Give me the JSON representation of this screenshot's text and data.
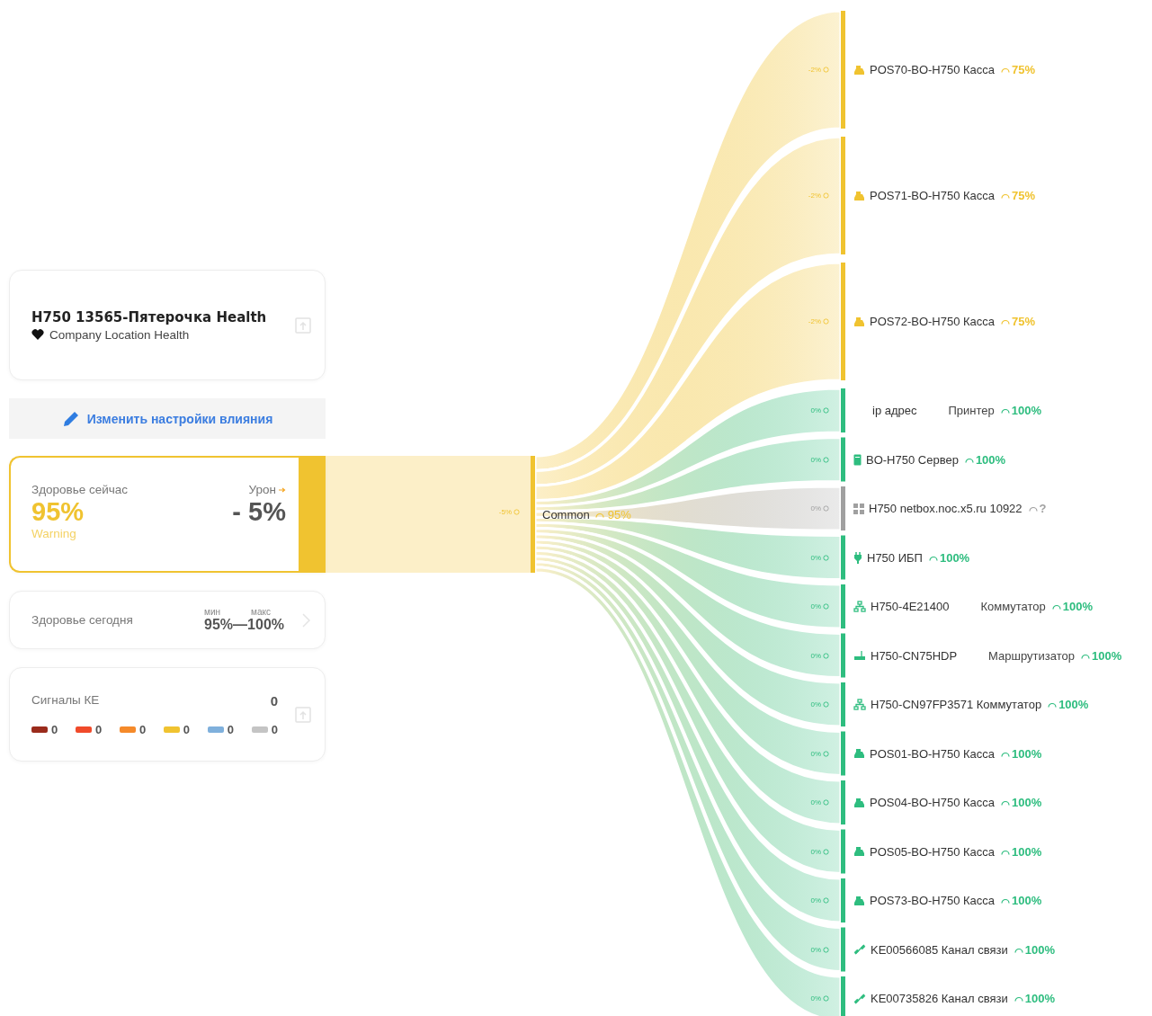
{
  "location": {
    "title": "H750 13565-Пятерочка Health",
    "subtitle": "Company Location Health"
  },
  "edit_button": "Изменить настройки влияния",
  "health_now": {
    "label": "Здоровье сейчас",
    "value": "95%",
    "color": "#f0c330",
    "status_label": "Warning",
    "damage_label": "Урон",
    "damage_value": "- 5%"
  },
  "health_today": {
    "label": "Здоровье сегодня",
    "min_label": "мин",
    "max_label": "макс",
    "min": "95%",
    "separator": "—",
    "max": "100%"
  },
  "signals": {
    "label": "Сигналы КЕ",
    "total": "0",
    "counts": [
      {
        "color": "#9a2b1c",
        "count": "0"
      },
      {
        "color": "#f04a2a",
        "count": "0"
      },
      {
        "color": "#f58a2a",
        "count": "0"
      },
      {
        "color": "#f0c330",
        "count": "0"
      },
      {
        "color": "#7fb0dc",
        "count": "0"
      },
      {
        "color": "#c4c4c4",
        "count": "0"
      }
    ]
  },
  "sankey": {
    "hub": {
      "name": "Common",
      "health": "95%",
      "impact": "-5%",
      "color": "#f0c330"
    },
    "nodes": [
      {
        "kind": "register",
        "name": "POS70-BO-H750 Касса",
        "health": "75%",
        "impact": "-2%",
        "color": "#f0c330"
      },
      {
        "kind": "register",
        "name": "POS71-BO-H750 Касса",
        "health": "75%",
        "impact": "-2%",
        "color": "#f0c330"
      },
      {
        "kind": "register",
        "name": "POS72-BO-H750 Касса",
        "health": "75%",
        "impact": "-2%",
        "color": "#f0c330"
      },
      {
        "name": "ip адрес",
        "type": "Принтер",
        "health": "100%",
        "impact": "0%",
        "color": "#2ebd7f"
      },
      {
        "kind": "server",
        "name": "BO-H750 Сервер",
        "health": "100%",
        "impact": "0%",
        "color": "#2ebd7f"
      },
      {
        "kind": "grid",
        "name": "H750 netbox.noc.x5.ru 10922",
        "health": "?",
        "impact": "0%",
        "color": "#a0a0a0"
      },
      {
        "kind": "plug",
        "name": "H750 ИБП",
        "health": "100%",
        "impact": "0%",
        "color": "#2ebd7f"
      },
      {
        "kind": "network",
        "name": "H750-4E21400",
        "type": "Коммутатор",
        "health": "100%",
        "impact": "0%",
        "color": "#2ebd7f"
      },
      {
        "kind": "router",
        "name": "H750-CN75HDP",
        "type": "Маршрутизатор",
        "health": "100%",
        "impact": "0%",
        "color": "#2ebd7f"
      },
      {
        "kind": "network",
        "name": "H750-CN97FP3571 Коммутатор",
        "health": "100%",
        "impact": "0%",
        "color": "#2ebd7f"
      },
      {
        "kind": "register",
        "name": "POS01-BO-H750 Касса",
        "health": "100%",
        "impact": "0%",
        "color": "#2ebd7f"
      },
      {
        "kind": "register",
        "name": "POS04-BO-H750 Касса",
        "health": "100%",
        "impact": "0%",
        "color": "#2ebd7f"
      },
      {
        "kind": "register",
        "name": "POS05-BO-H750 Касса",
        "health": "100%",
        "impact": "0%",
        "color": "#2ebd7f"
      },
      {
        "kind": "register",
        "name": "POS73-BO-H750 Касса",
        "health": "100%",
        "impact": "0%",
        "color": "#2ebd7f"
      },
      {
        "kind": "link",
        "name": "KE00566085 Канал связи",
        "health": "100%",
        "impact": "0%",
        "color": "#2ebd7f"
      },
      {
        "kind": "link",
        "name": "KE00735826 Канал связи",
        "health": "100%",
        "impact": "0%",
        "color": "#2ebd7f"
      }
    ]
  }
}
